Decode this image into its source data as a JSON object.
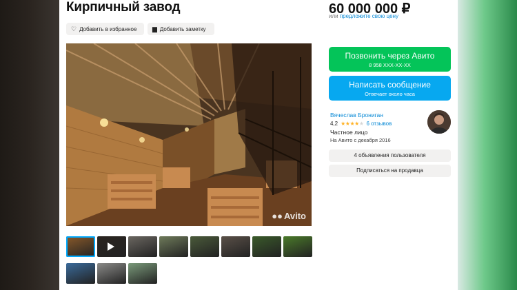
{
  "listing": {
    "title": "Кирпичный завод",
    "favorite_label": "Добавить в избранное",
    "note_label": "Добавить заметку",
    "watermark": "Avito"
  },
  "thumbnails": [
    {
      "kind": "photo",
      "active": true,
      "color": "#8a5a2a"
    },
    {
      "kind": "video",
      "active": false,
      "color": "#2a2420"
    },
    {
      "kind": "photo",
      "active": false,
      "color": "#6a6660"
    },
    {
      "kind": "photo",
      "active": false,
      "color": "#6e7a5a"
    },
    {
      "kind": "photo",
      "active": false,
      "color": "#4a5a3a"
    },
    {
      "kind": "photo",
      "active": false,
      "color": "#5a5048"
    },
    {
      "kind": "photo",
      "active": false,
      "color": "#3a5a2a"
    },
    {
      "kind": "photo",
      "active": false,
      "color": "#4a7a2a"
    },
    {
      "kind": "photo",
      "active": false,
      "color": "#3a6a9a"
    },
    {
      "kind": "photo",
      "active": false,
      "color": "#8a8a88"
    },
    {
      "kind": "photo",
      "active": false,
      "color": "#7a9a7a"
    }
  ],
  "sidebar": {
    "price": "60 000 000 ₽",
    "price_or": "или",
    "price_offer": "предложите свою цену",
    "call": {
      "label": "Позвонить через Авито",
      "phone": "8 958 XXX-XX-XX"
    },
    "message": {
      "label": "Написать сообщение",
      "sub": "Отвечает около часа"
    },
    "seller": {
      "name": "Вячеслав Брониган",
      "rating": "4,2",
      "rating_value": 4.2,
      "reviews": "6 отзывов",
      "type": "Частное лицо",
      "since": "На Авито с декабря 2016"
    },
    "user_listings": "4 объявления пользователя",
    "subscribe": "Подписаться на продавца"
  },
  "colors": {
    "call_green": "#04c459",
    "message_blue": "#07a8f0",
    "link_blue": "#0a8ad6",
    "star": "#ffb021"
  }
}
